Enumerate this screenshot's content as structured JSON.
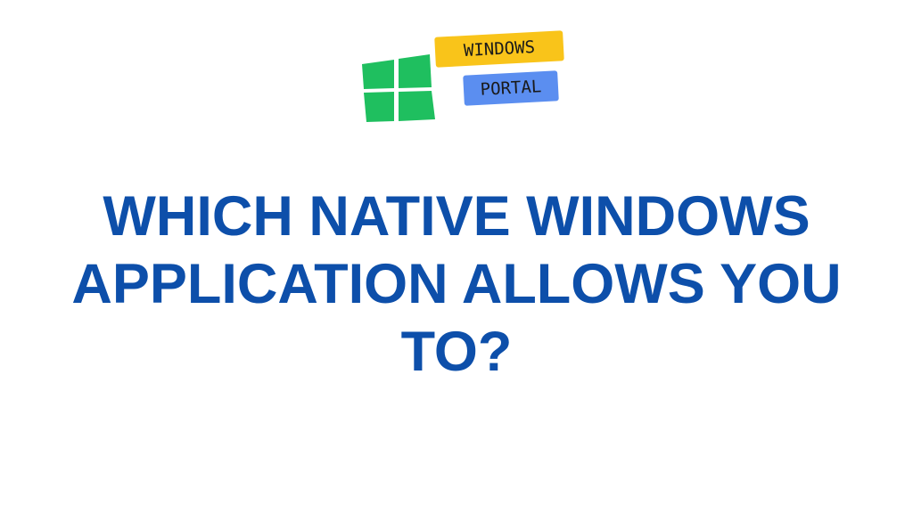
{
  "logo": {
    "line1": "WINDOWS",
    "line2": "PORTAL",
    "icon": "windows-logo-icon",
    "colors": {
      "tiles": "#1fbf5f",
      "tag_yellow": "#f9c41a",
      "tag_blue": "#5b8ef0"
    }
  },
  "headline": {
    "text": "WHICH NATIVE WINDOWS APPLICATION ALLOWS YOU TO?",
    "color": "#0d4faa"
  }
}
